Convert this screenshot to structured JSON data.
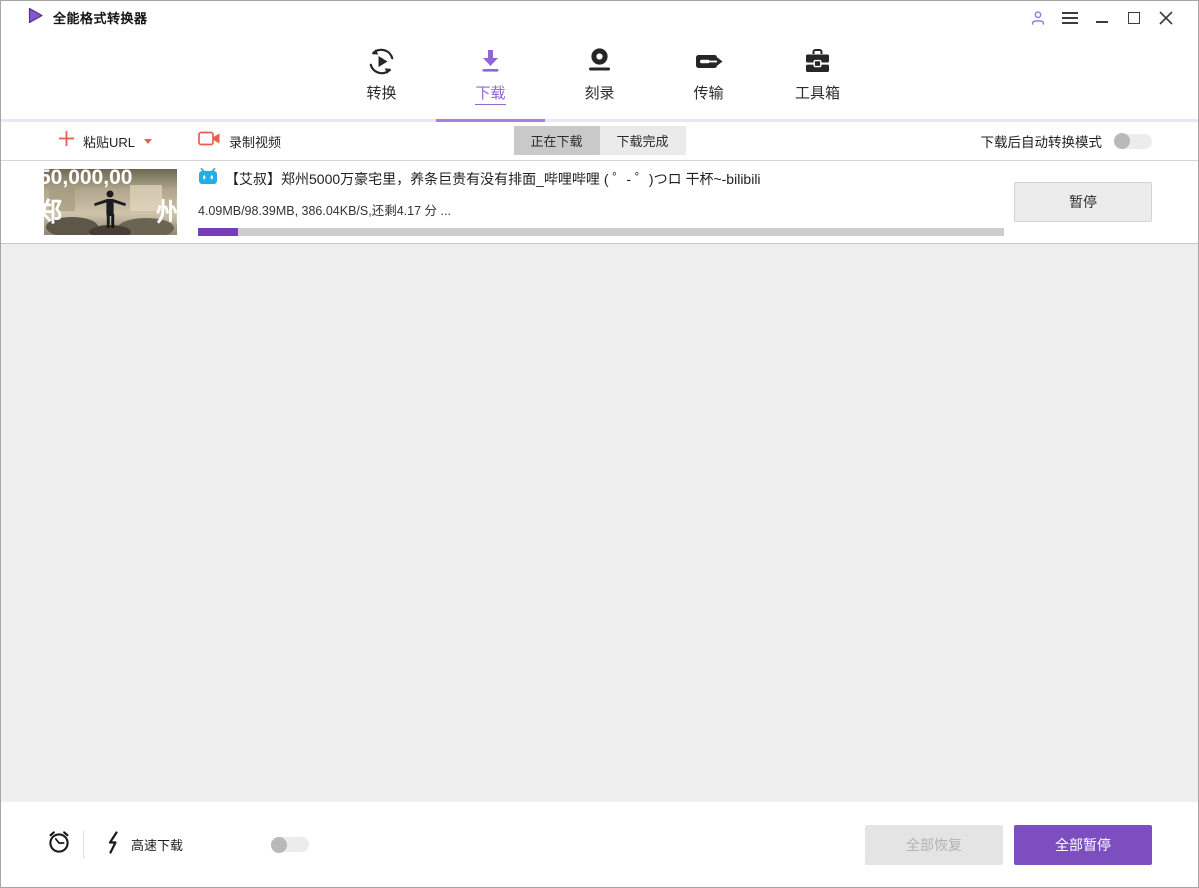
{
  "titlebar": {
    "app_title": "全能格式转换器"
  },
  "nav": {
    "active_tab": "下载",
    "tabs": [
      {
        "label": "转换",
        "icon": "convert-icon"
      },
      {
        "label": "下载",
        "icon": "download-icon"
      },
      {
        "label": "刻录",
        "icon": "burn-icon"
      },
      {
        "label": "传输",
        "icon": "transfer-icon"
      },
      {
        "label": "工具箱",
        "icon": "toolbox-icon"
      }
    ]
  },
  "toolbar": {
    "paste_url": "粘贴URL",
    "record_video": "录制视频",
    "filter_tabs": [
      {
        "label": "正在下载",
        "active": true
      },
      {
        "label": "下载完成",
        "active": false
      }
    ],
    "auto_convert_label": "下载后自动转换模式",
    "auto_convert_enabled": false
  },
  "download_list": {
    "items": [
      {
        "source": "bilibili",
        "title": "【艾叔】郑州5000万豪宅里，养条巨贵有没有排面_哔哩哔哩 ( ゜- ゜)つロ 干杯~-bilibili",
        "progress_text": "4.09MB/98.39MB, 386.04KB/S,还剩4.17 分 ...",
        "progress_percent": 5,
        "pause_label": "暂停",
        "thumbnail": {
          "headline": "50,000,00",
          "left_char": "郑",
          "right_char": "州"
        }
      }
    ]
  },
  "footer": {
    "high_speed_label": "高速下载",
    "high_speed_enabled": false,
    "resume_all_label": "全部恢复",
    "pause_all_label": "全部暂停"
  },
  "colors": {
    "accent_purple": "#8f67d8",
    "nav_indicator": "#a57fe2",
    "progress_purple": "#7a3db8",
    "pause_all_purple": "#7d4ec0",
    "coral_red": "#e8604c",
    "bilibili_blue": "#23ade5"
  }
}
